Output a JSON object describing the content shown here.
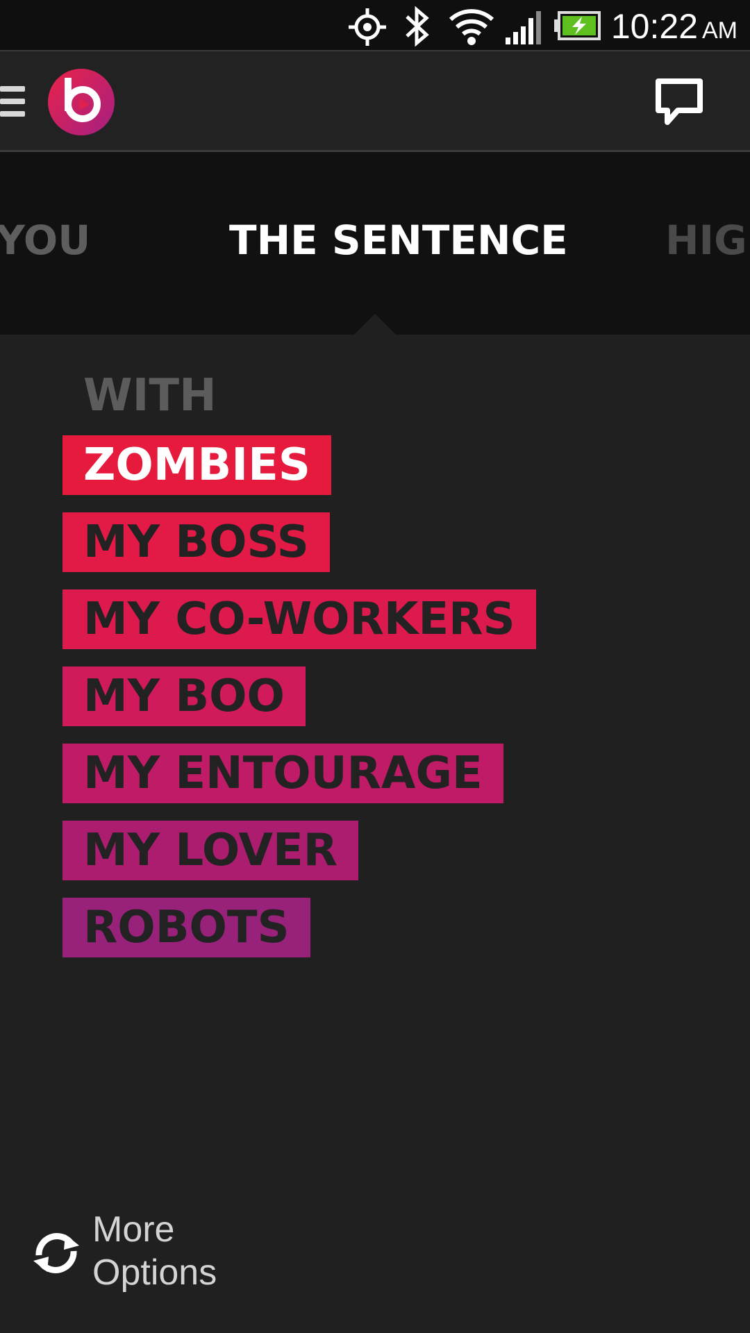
{
  "status_bar": {
    "icons": [
      "gps-icon",
      "bluetooth-icon",
      "wifi-icon",
      "signal-icon",
      "battery-charging-icon"
    ],
    "time": "10:22",
    "ampm": "AM"
  },
  "app_bar": {
    "menu_icon": "hamburger-menu-icon",
    "logo": "beats-logo",
    "chat_icon": "chat-bubble-icon"
  },
  "tabs": [
    {
      "label": "YOU",
      "state": "inactive"
    },
    {
      "label": "THE SENTENCE",
      "state": "active"
    },
    {
      "label": "HIGH",
      "state": "inactive"
    }
  ],
  "sentence": {
    "prompt": "WITH",
    "options": [
      {
        "label": "ZOMBIES",
        "selected": true,
        "color": "#e61a3c"
      },
      {
        "label": "MY BOSS",
        "selected": false,
        "color": "#e21a45"
      },
      {
        "label": "MY CO-WORKERS",
        "selected": false,
        "color": "#dc1a4e"
      },
      {
        "label": "MY BOO",
        "selected": false,
        "color": "#d01a5c"
      },
      {
        "label": "MY ENTOURAGE",
        "selected": false,
        "color": "#bf1b66"
      },
      {
        "label": "MY LOVER",
        "selected": false,
        "color": "#ac1c6f"
      },
      {
        "label": "ROBOTS",
        "selected": false,
        "color": "#98217a"
      }
    ]
  },
  "footer": {
    "more_options": [
      "More",
      "Options"
    ],
    "icon": "refresh-icon"
  },
  "colors": {
    "background": "#202020",
    "tab_strip": "#111111",
    "app_bar": "#222222",
    "accent": "#e61a3c"
  }
}
